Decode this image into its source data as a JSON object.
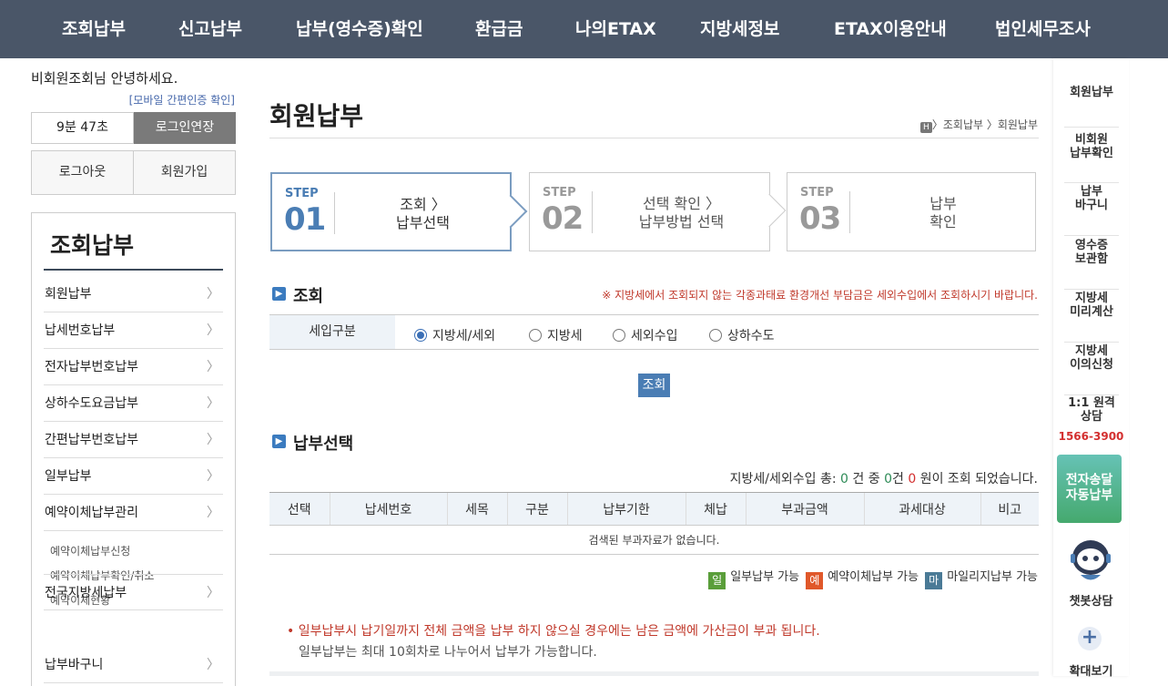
{
  "topnav": [
    "조회납부",
    "신고납부",
    "납부(영수증)확인",
    "환급금",
    "나의ETAX",
    "지방세정보",
    "ETAX이용안내",
    "법인세무조사"
  ],
  "user": {
    "name": "비회원조회",
    "greeting_suffix": "님 안녕하세요.",
    "mobile_auth": "[모바일 간편인증 확인]",
    "timer": "9분 47초",
    "extend": "로그인연장",
    "logout": "로그아웃",
    "join": "회원가입"
  },
  "sidebar": {
    "title": "조회납부",
    "items": [
      "회원납부",
      "납세번호납부",
      "전자납부번호납부",
      "상하수도요금납부",
      "간편납부번호납부",
      "일부납부",
      "예약이체납부관리"
    ],
    "subitems": [
      "예약이체납부신청",
      "예약이체납부확인/취소",
      "예약이체현황"
    ],
    "items_after": [
      "전국지방세납부",
      "납부바구니"
    ],
    "chevron": "〉"
  },
  "main": {
    "title": "회원납부",
    "breadcrumb_home": "H",
    "breadcrumb": "〉조회납부 〉회원납부",
    "steps": [
      {
        "label": "STEP",
        "num": "01",
        "line1": "조회 〉",
        "line2": "납부선택"
      },
      {
        "label": "STEP",
        "num": "02",
        "line1": "선택 확인 〉",
        "line2": "납부방법 선택"
      },
      {
        "label": "STEP",
        "num": "03",
        "line1": "납부",
        "line2": "확인"
      }
    ],
    "inquiry": {
      "title": "조회",
      "notice": "※ 지방세에서 조회되지 않는 각종과태료 환경개선 부담금은 세외수입에서 조회하시기 바랍니다.",
      "filter_label": "세입구분",
      "options": [
        "지방세/세외",
        "지방세",
        "세외수입",
        "상하수도"
      ],
      "selected": "지방세/세외",
      "search_button": "조회"
    },
    "payment": {
      "title": "납부선택",
      "summary_prefix": "지방세/세외수입 총:",
      "count": "0",
      "summary_mid1": "건 중",
      "selected_count": "0",
      "summary_mid2": "건",
      "amount": "0",
      "summary_suffix": "원이 조회 되었습니다.",
      "columns": [
        "선택",
        "납세번호",
        "세목",
        "구분",
        "납부기한",
        "체납",
        "부과금액",
        "과세대상",
        "비고"
      ],
      "empty_message": "검색된 부과자료가 없습니다.",
      "legend": [
        {
          "badge": "일",
          "text": "일부납부 가능",
          "color": "#5a9e3a"
        },
        {
          "badge": "예",
          "text": "예약이체납부 가능",
          "color": "#e0582a"
        },
        {
          "badge": "마",
          "text": "마일리지납부 가능",
          "color": "#4a7a96"
        }
      ],
      "note_red": "• 일부납부시 납기일까지 전체 금액을 납부 하지 않으실 경우에는 남은 금액에 가산금이 부과 됩니다.",
      "note_grey": "일부납부는 최대 10회차로 나누어서 납부가 가능합니다."
    }
  },
  "quickbar": {
    "items": [
      "회원납부",
      "비회원\n납부확인",
      "납부\n바구니",
      "영수증\n보관함",
      "지방세\n미리계산",
      "지방세\n이의신청",
      "1:1 원격\n상담"
    ],
    "phone": "1566-3900",
    "green": "전자송달\n자동납부",
    "chatbot": "챗봇상담",
    "zoom": "확대보기"
  }
}
